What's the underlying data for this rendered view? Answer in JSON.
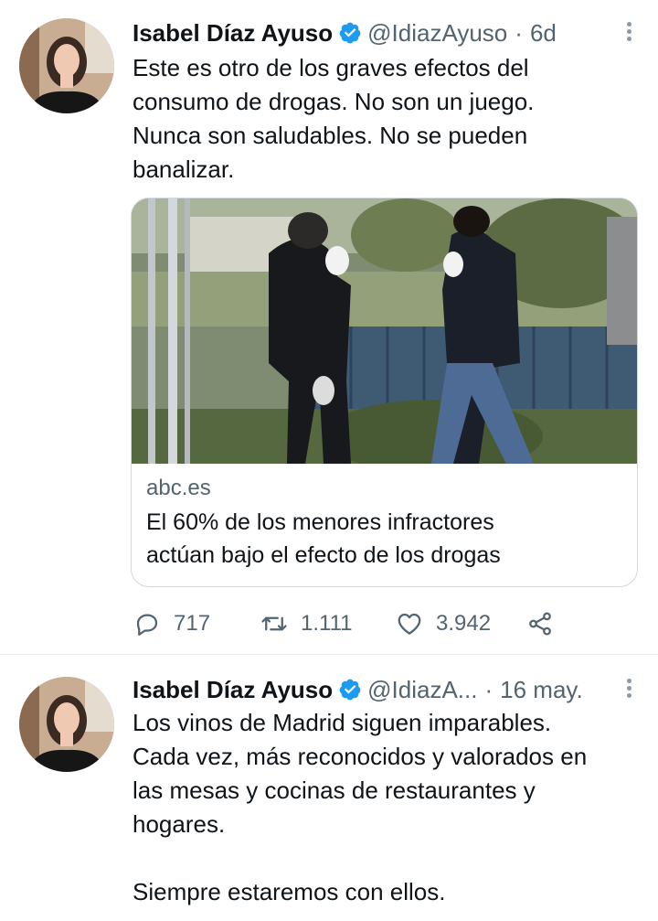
{
  "tweets": [
    {
      "author": {
        "name": "Isabel Díaz Ayuso",
        "handle": "@IdiazAyuso"
      },
      "time": "6d",
      "text": "Este es otro de los graves efectos del\nconsumo de drogas. No son un juego.\nNunca son saludables. No se pueden\nbanalizar.",
      "card": {
        "domain": "abc.es",
        "title": "El 60% de los menores infractores\nactúan bajo el efecto de los drogas"
      },
      "actions": {
        "replies": "717",
        "retweets": "1.111",
        "likes": "3.942"
      }
    },
    {
      "author": {
        "name": "Isabel Díaz Ayuso",
        "handle": "@IdiazA..."
      },
      "time": "16 may.",
      "text": "Los vinos de Madrid siguen imparables.\nCada vez, más reconocidos y valorados en\nlas mesas y cocinas de restaurantes y\nhogares.\n\nSiempre estaremos con ellos."
    }
  ],
  "colors": {
    "accent": "#1d9bf0",
    "muted": "#536471",
    "border": "#cfd9de"
  },
  "icons": [
    "verified-badge-icon",
    "more-icon",
    "reply-icon",
    "retweet-icon",
    "like-icon",
    "share-icon"
  ]
}
